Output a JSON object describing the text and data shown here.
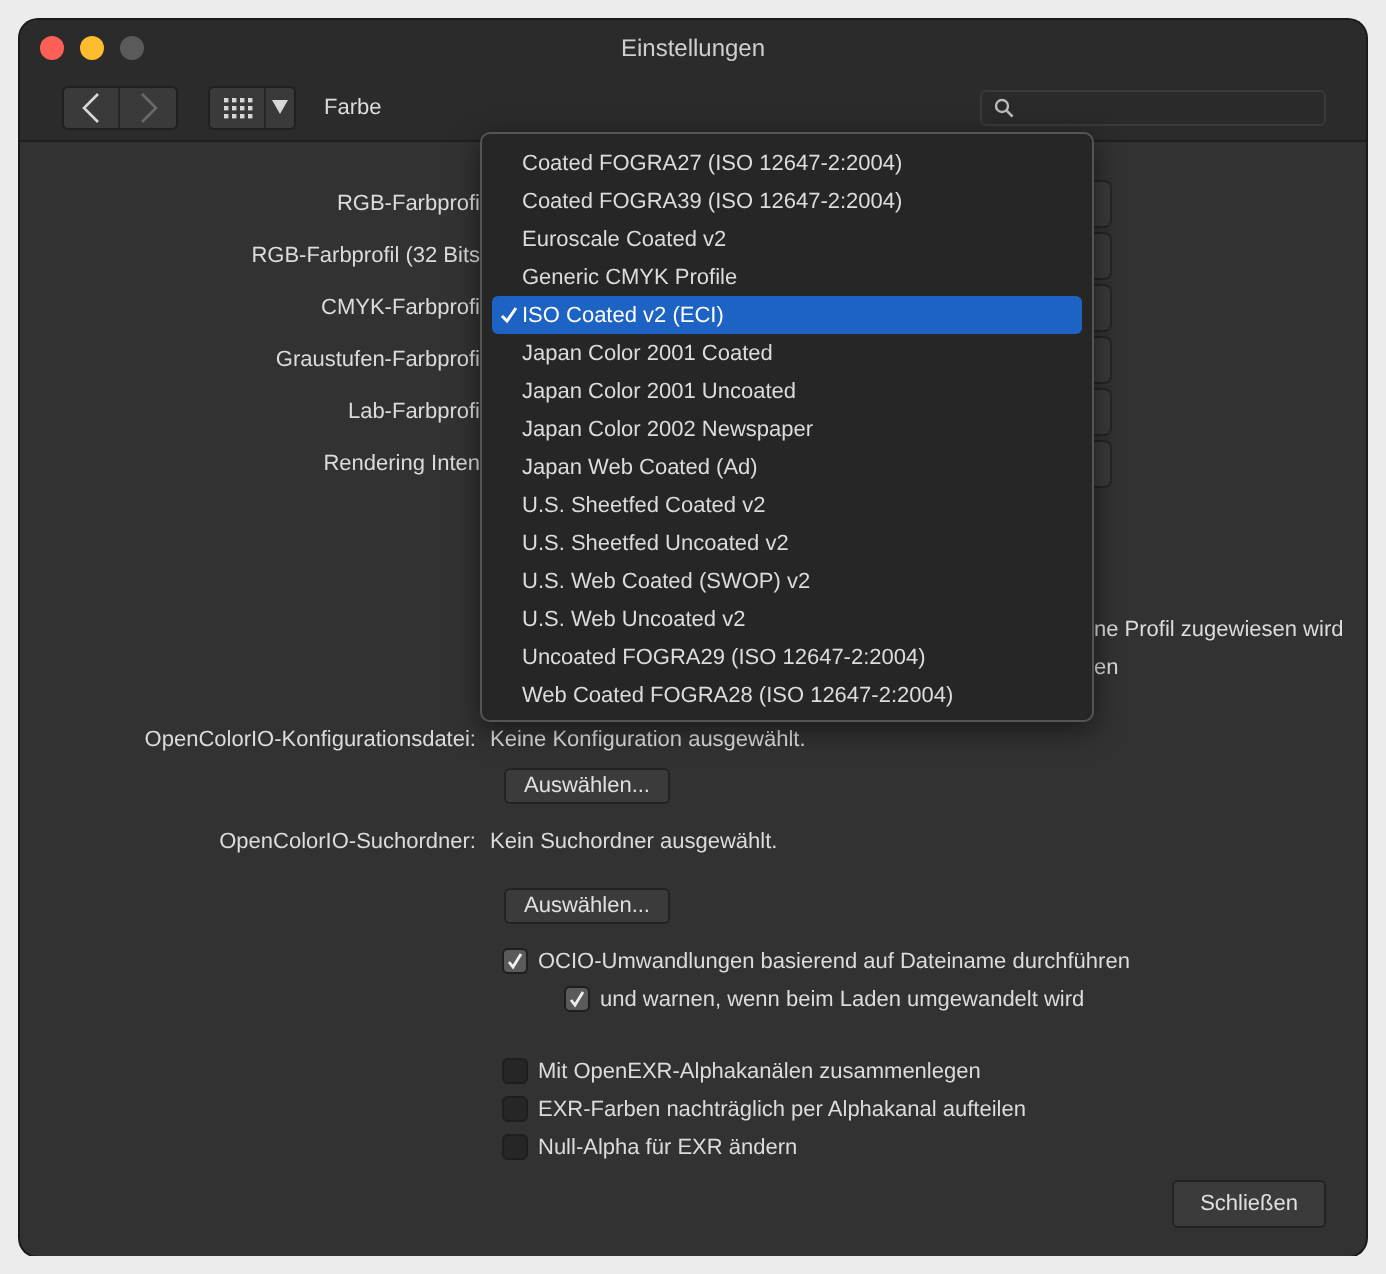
{
  "window": {
    "title": "Einstellungen"
  },
  "toolbar": {
    "nav": [
      {
        "kind": "back",
        "disabled": false
      },
      {
        "kind": "forward",
        "disabled": true
      }
    ],
    "section": "Farbe"
  },
  "profile_rows": [
    {
      "label": "RGB-Farbprofi"
    },
    {
      "label": "RGB-Farbprofil (32 Bits"
    },
    {
      "label": "CMYK-Farbprofi"
    },
    {
      "label": "Graustufen-Farbprofi"
    },
    {
      "label": "Lab-Farbprofi"
    },
    {
      "label": "Rendering Inten"
    }
  ],
  "notes": [
    {
      "text": "ne Profil zugewiesen wird"
    },
    {
      "text": "en"
    }
  ],
  "ocio": [
    {
      "label": "OpenColorIO-Konfigurationsdatei:",
      "value": "Keine Konfiguration ausgewählt.",
      "button": "Auswählen..."
    },
    {
      "label": "OpenColorIO-Suchordner:",
      "value": "Kein Suchordner ausgewählt.",
      "button": "Auswählen..."
    }
  ],
  "checkbox_groups": [
    [
      {
        "label": "OCIO-Umwandlungen basierend auf Dateiname durchführen",
        "checked": true,
        "children": [
          {
            "label": "und warnen, wenn beim Laden umgewandelt wird",
            "checked": true
          }
        ]
      }
    ],
    [
      {
        "label": "Mit OpenEXR-Alphakanälen zusammenlegen",
        "checked": false
      },
      {
        "label": "EXR-Farben nachträglich per Alphakanal aufteilen",
        "checked": false
      },
      {
        "label": "Null-Alpha für EXR ändern",
        "checked": false
      }
    ]
  ],
  "close_button": "Schließen",
  "menu": {
    "items": [
      {
        "label": "Coated FOGRA27 (ISO 12647-2:2004)",
        "selected": false
      },
      {
        "label": "Coated FOGRA39 (ISO 12647-2:2004)",
        "selected": false
      },
      {
        "label": "Euroscale Coated v2",
        "selected": false
      },
      {
        "label": "Generic CMYK Profile",
        "selected": false
      },
      {
        "label": "ISO Coated v2 (ECI)",
        "selected": true
      },
      {
        "label": "Japan Color 2001 Coated",
        "selected": false
      },
      {
        "label": "Japan Color 2001 Uncoated",
        "selected": false
      },
      {
        "label": "Japan Color 2002 Newspaper",
        "selected": false
      },
      {
        "label": "Japan Web Coated (Ad)",
        "selected": false
      },
      {
        "label": "U.S. Sheetfed Coated v2",
        "selected": false
      },
      {
        "label": "U.S. Sheetfed Uncoated v2",
        "selected": false
      },
      {
        "label": "U.S. Web Coated (SWOP) v2",
        "selected": false
      },
      {
        "label": "U.S. Web Uncoated v2",
        "selected": false
      },
      {
        "label": "Uncoated FOGRA29 (ISO 12647-2:2004)",
        "selected": false
      },
      {
        "label": "Web Coated FOGRA28 (ISO 12647-2:2004)",
        "selected": false
      }
    ]
  }
}
